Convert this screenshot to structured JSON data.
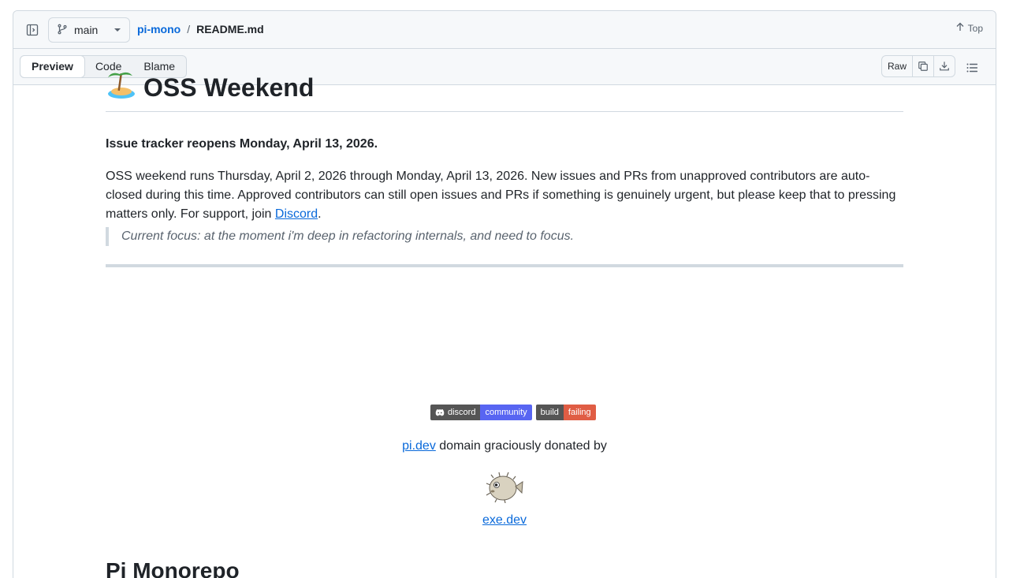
{
  "header": {
    "branch": "main",
    "repo": "pi-mono",
    "separator": "/",
    "file": "README.md",
    "top_label": "Top"
  },
  "toolbar": {
    "tabs": [
      {
        "label": "Preview",
        "active": true
      },
      {
        "label": "Code",
        "active": false
      },
      {
        "label": "Blame",
        "active": false
      }
    ],
    "raw_label": "Raw"
  },
  "content": {
    "heading": "OSS Weekend",
    "notice": "Issue tracker reopens Monday, April 13, 2026.",
    "paragraph": "OSS weekend runs Thursday, April 2, 2026 through Monday, April 13, 2026. New issues and PRs from unapproved contributors are auto-closed during this time. Approved contributors can still open issues and PRs if something is genuinely urgent, but please keep that to pressing matters only. For support, join ",
    "paragraph_link": "Discord",
    "paragraph_end": ".",
    "quote": "Current focus: at the moment i'm deep in refactoring internals, and need to focus.",
    "badges": [
      {
        "left": "discord",
        "right": "community",
        "color": "#5865f2"
      },
      {
        "left": "build",
        "right": "failing",
        "color": "#e05d44"
      }
    ],
    "domain_link": "pi.dev",
    "domain_text": " domain graciously donated by",
    "sponsor_link": "exe.dev",
    "heading2": "Pi Monorepo"
  }
}
